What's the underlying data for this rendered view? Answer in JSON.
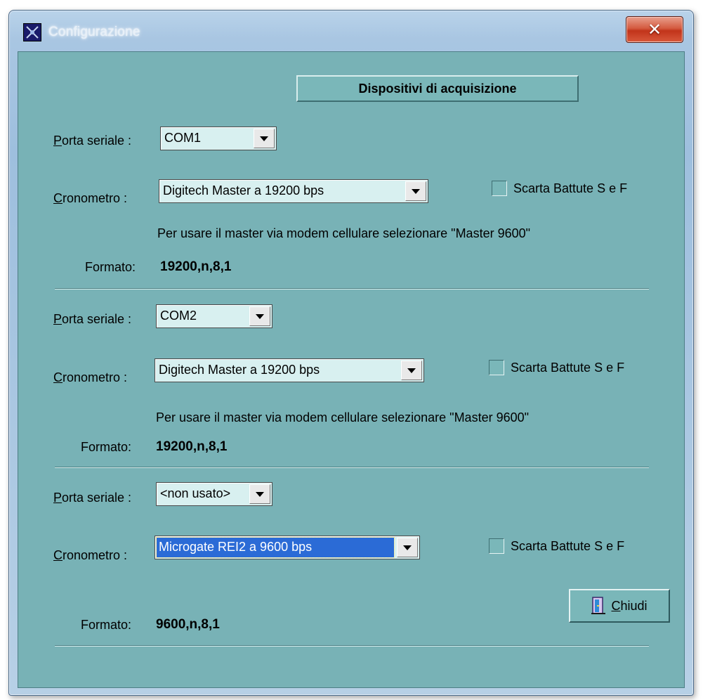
{
  "window": {
    "title": "Configurazione",
    "close_glyph": "✕"
  },
  "header": {
    "label": "Dispositivi di acquisizione"
  },
  "groups": [
    {
      "port_label_u": "P",
      "port_label": "orta seriale :",
      "port_value": "COM1",
      "chrono_label_u": "C",
      "chrono_label": "ronometro :",
      "chrono_value": "Digitech Master a 19200 bps",
      "checkbox_label": "Scarta Battute S e F",
      "note": "Per usare il master via modem cellulare selezionare \"Master 9600\"",
      "format_label": "Formato:",
      "format_value": "19200,n,8,1"
    },
    {
      "port_label_u": "P",
      "port_label": "orta seriale :",
      "port_value": "COM2",
      "chrono_label_u": "C",
      "chrono_label": "ronometro :",
      "chrono_value": "Digitech Master a 19200 bps",
      "checkbox_label": "Scarta Battute S e F",
      "note": "Per usare il master via modem cellulare selezionare \"Master 9600\"",
      "format_label": "Formato:",
      "format_value": "19200,n,8,1"
    },
    {
      "port_label_u": "P",
      "port_label": "orta seriale :",
      "port_value": "<non usato>",
      "chrono_label_u": "C",
      "chrono_label": "ronometro :",
      "chrono_value": "Microgate REI2 a 9600 bps",
      "checkbox_label": "Scarta Battute S e F",
      "format_label": "Formato:",
      "format_value": "9600,n,8,1"
    }
  ],
  "footer": {
    "close_u": "C",
    "close_label": "hiudi"
  },
  "colors": {
    "client_bg": "#78b2b6",
    "selection": "#2b6bd6"
  }
}
